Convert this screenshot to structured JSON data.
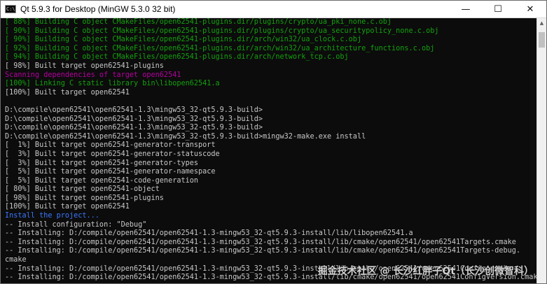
{
  "window": {
    "title": "Qt 5.9.3 for Desktop (MinGW 5.3.0 32 bit)",
    "app_icon_glyph": "C:\\",
    "controls": {
      "minimize": "—",
      "maximize": "☐",
      "close": "✕"
    }
  },
  "colors": {
    "green": "#13a10e",
    "magenta": "#b4009e",
    "blue": "#3b78ff",
    "white": "#c8c8c8"
  },
  "console": {
    "lines": [
      {
        "text": "[ 88%] Building C object CMakeFiles/open62541-plugins.dir/plugins/crypto/ua_pki_none.c.obj",
        "color": "green"
      },
      {
        "text": "[ 90%] Building C object CMakeFiles/open62541-plugins.dir/plugins/crypto/ua_securitypolicy_none.c.obj",
        "color": "green"
      },
      {
        "text": "[ 90%] Building C object CMakeFiles/open62541-plugins.dir/arch/win32/ua_clock.c.obj",
        "color": "green"
      },
      {
        "text": "[ 92%] Building C object CMakeFiles/open62541-plugins.dir/arch/win32/ua_architecture_functions.c.obj",
        "color": "green"
      },
      {
        "text": "[ 94%] Building C object CMakeFiles/open62541-plugins.dir/arch/network_tcp.c.obj",
        "color": "green"
      },
      {
        "text": "[ 98%] Built target open62541-plugins",
        "color": "white"
      },
      {
        "text": "Scanning dependencies of target open62541",
        "color": "magenta"
      },
      {
        "text": "[100%] Linking C static library bin\\libopen62541.a",
        "color": "green"
      },
      {
        "text": "[100%] Built target open62541",
        "color": "white"
      },
      {
        "text": "",
        "color": "white"
      },
      {
        "text": "D:\\compile\\open62541\\open62541-1.3\\mingw53_32-qt5.9.3-build>",
        "color": "white"
      },
      {
        "text": "D:\\compile\\open62541\\open62541-1.3\\mingw53_32-qt5.9.3-build>",
        "color": "white"
      },
      {
        "text": "D:\\compile\\open62541\\open62541-1.3\\mingw53_32-qt5.9.3-build>",
        "color": "white"
      },
      {
        "text": "D:\\compile\\open62541\\open62541-1.3\\mingw53_32-qt5.9.3-build>mingw32-make.exe install",
        "color": "white"
      },
      {
        "text": "[  1%] Built target open62541-generator-transport",
        "color": "white"
      },
      {
        "text": "[  3%] Built target open62541-generator-statuscode",
        "color": "white"
      },
      {
        "text": "[  3%] Built target open62541-generator-types",
        "color": "white"
      },
      {
        "text": "[  5%] Built target open62541-generator-namespace",
        "color": "white"
      },
      {
        "text": "[  5%] Built target open62541-code-generation",
        "color": "white"
      },
      {
        "text": "[ 80%] Built target open62541-object",
        "color": "white"
      },
      {
        "text": "[ 98%] Built target open62541-plugins",
        "color": "white"
      },
      {
        "text": "[100%] Built target open62541",
        "color": "white"
      },
      {
        "text": "Install the project...",
        "color": "blue"
      },
      {
        "text": "-- Install configuration: \"Debug\"",
        "color": "white"
      },
      {
        "text": "-- Installing: D:/compile/open62541/open62541-1.3-mingw53_32-qt5.9.3-install/lib/libopen62541.a",
        "color": "white"
      },
      {
        "text": "-- Installing: D:/compile/open62541/open62541-1.3-mingw53_32-qt5.9.3-install/lib/cmake/open62541/open62541Targets.cmake",
        "color": "white"
      },
      {
        "text": "-- Installing: D:/compile/open62541/open62541-1.3-mingw53_32-qt5.9.3-install/lib/cmake/open62541/open62541Targets-debug.",
        "color": "white"
      },
      {
        "text": "cmake",
        "color": "white"
      },
      {
        "text": "-- Installing: D:/compile/open62541/open62541-1.3-mingw53_32-qt5.9.3-install/lib/cmake/open62541/open62541Config.cmake",
        "color": "white"
      },
      {
        "text": "-- Installing: D:/compile/open62541/open62541-1.3-mingw53_32-qt5.9.3-install/lib/cmake/open62541/open62541ConfigVersion.cmake",
        "color": "white"
      }
    ]
  },
  "watermark": "掘金技术社区 @ 长沙红胖子Qt（长沙创微智科）",
  "scrollbar": {
    "up_arrow": "▲"
  }
}
